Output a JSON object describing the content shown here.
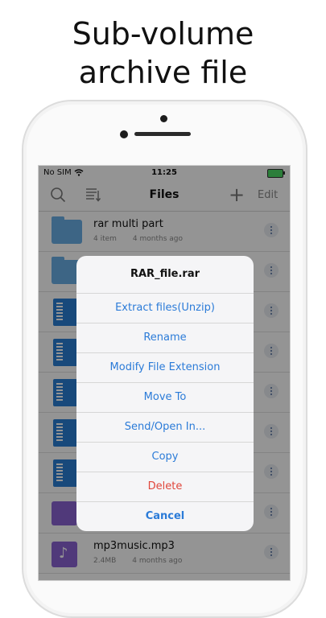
{
  "headline": {
    "line1": "Sub-volume",
    "line2": "archive file"
  },
  "status_bar": {
    "carrier": "No SIM",
    "time": "11:25"
  },
  "nav": {
    "title": "Files",
    "edit_label": "Edit",
    "plus_label": "+"
  },
  "files": [
    {
      "name": "rar multi part",
      "size": "4 item",
      "date": "4 months ago",
      "icon": "folder-icon"
    },
    {
      "name": "",
      "size": "",
      "date": "",
      "icon": "folder-icon"
    },
    {
      "name": "",
      "size": "",
      "date": "",
      "icon": "zip-file-icon"
    },
    {
      "name": "",
      "size": "",
      "date": "",
      "icon": "zip-file-icon"
    },
    {
      "name": "",
      "size": "",
      "date": "",
      "icon": "zip-file-icon"
    },
    {
      "name": "",
      "size": "",
      "date": "",
      "icon": "zip-file-icon"
    },
    {
      "name": "",
      "size": "",
      "date": "",
      "icon": "zip-file-icon"
    },
    {
      "name": "",
      "size": "",
      "date": "",
      "icon": "video-file-icon"
    },
    {
      "name": "mp3music.mp3",
      "size": "2.4MB",
      "date": "4 months ago",
      "icon": "music-file-icon"
    }
  ],
  "action_sheet": {
    "title": "RAR_file.rar",
    "options": [
      "Extract files(Unzip)",
      "Rename",
      "Modify File Extension",
      "Move To",
      "Send/Open In...",
      "Copy"
    ],
    "delete_label": "Delete",
    "cancel_label": "Cancel"
  },
  "colors": {
    "accent": "#2b7bd8",
    "destructive": "#e0463b",
    "folder": "#6aaee6",
    "zip": "#2a7fd4",
    "media": "#8b63d2"
  }
}
